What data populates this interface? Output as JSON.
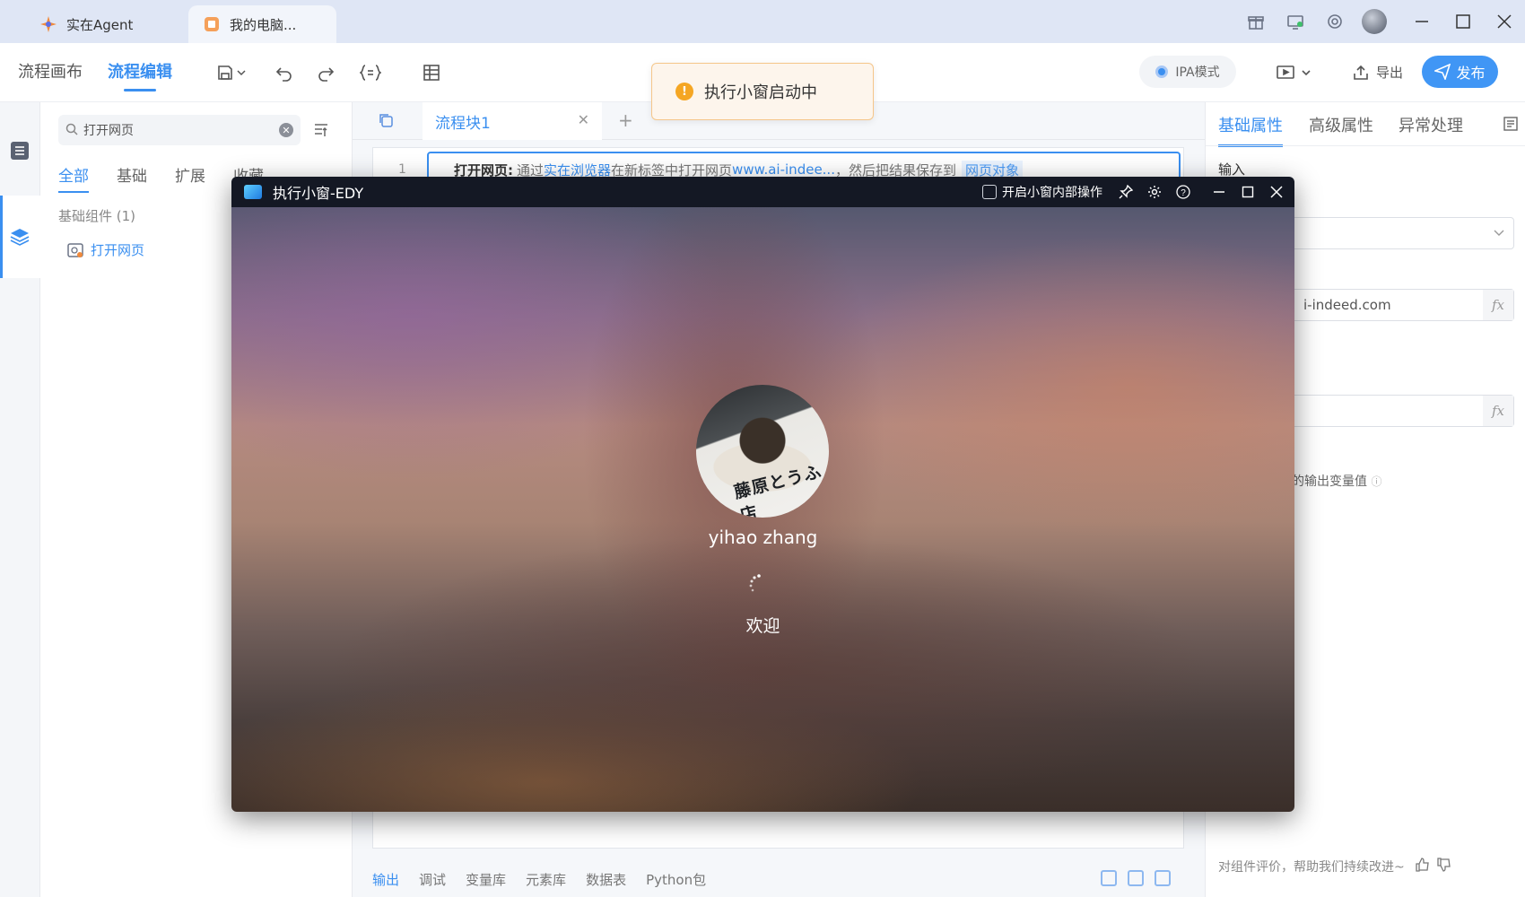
{
  "browser": {
    "tabs": [
      {
        "label": "实在Agent"
      },
      {
        "label": "我的电脑..."
      }
    ]
  },
  "header": {
    "tabs": [
      {
        "label": "流程画布"
      },
      {
        "label": "流程编辑",
        "active": true
      }
    ],
    "ipa_mode": "IPA模式",
    "export_label": "导出",
    "publish_label": "发布"
  },
  "toast": {
    "message": "执行小窗启动中"
  },
  "components": {
    "search_value": "打开网页",
    "tabs": [
      {
        "label": "全部",
        "active": true
      },
      {
        "label": "基础"
      },
      {
        "label": "扩展"
      },
      {
        "label": "收藏"
      }
    ],
    "group_title": "基础组件 (1)",
    "items": [
      {
        "label": "打开网页"
      }
    ]
  },
  "editor": {
    "tab_label": "流程块1",
    "line_number": "1",
    "line": {
      "command": "打开网页:",
      "t1": "通过",
      "browser_link": "实在浏览器",
      "t2": "在新标签中打开网页",
      "url_link": "www.ai-indee...",
      "t3": "，然后把结果保存到",
      "var_link": "网页对象"
    },
    "bottom_tabs": [
      {
        "label": "输出",
        "active": true
      },
      {
        "label": "调试"
      },
      {
        "label": "变量库"
      },
      {
        "label": "元素库"
      },
      {
        "label": "数据表"
      },
      {
        "label": "Python包"
      }
    ]
  },
  "properties": {
    "tabs": [
      {
        "label": "基础属性",
        "active": true
      },
      {
        "label": "高级属性"
      },
      {
        "label": "异常处理"
      }
    ],
    "input_label": "输入",
    "url_value": "i-indeed.com",
    "fx_label": "fx",
    "output_hint": "的输出变量值",
    "feedback": "对组件评价，帮助我们持续改进~"
  },
  "miniwindow": {
    "title": "执行小窗-EDY",
    "checkbox_label": "开启小窗内部操作",
    "car_text": "藤原とうふ店",
    "user_name": "yihao zhang",
    "welcome": "欢迎"
  },
  "colors": {
    "accent": "#3a8ff0",
    "publish_bg": "#4096f5",
    "toast_bg": "#fdf5ec",
    "warn": "#f5a623",
    "miniwindow_bar": "#141824"
  }
}
